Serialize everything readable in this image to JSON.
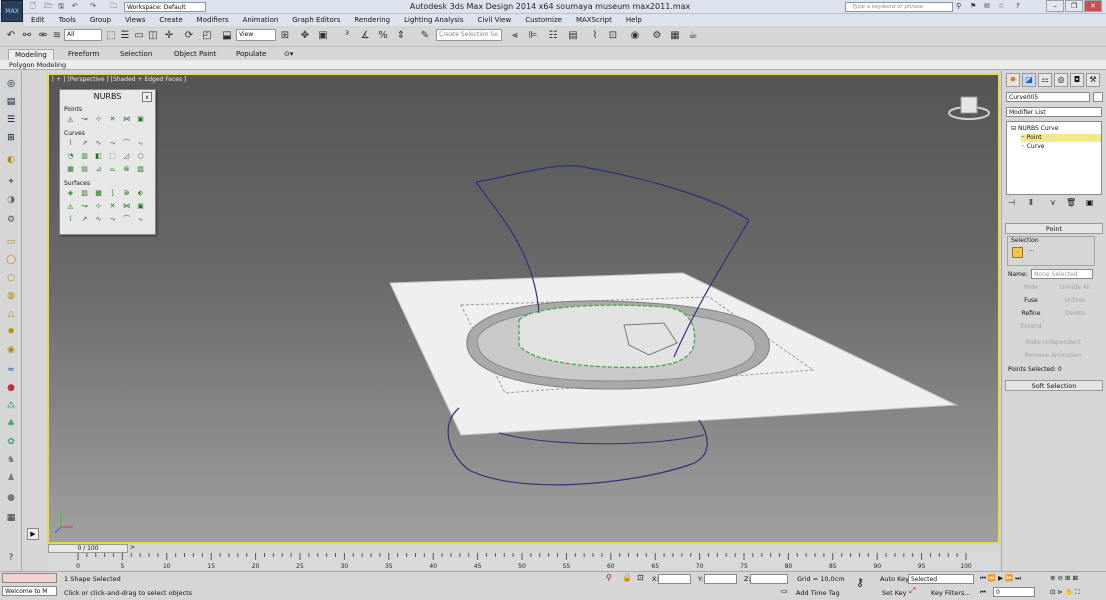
{
  "window": {
    "title": "Autodesk 3ds Max Design 2014 x64     soumaya museum max2011.max",
    "app_icon": "MAX",
    "workspace": "Workspace: Default",
    "search_placeholder": "Type a keyword or phrase",
    "minimize": "–",
    "maximize": "❐",
    "close": "✕"
  },
  "menus": [
    "Edit",
    "Tools",
    "Group",
    "Views",
    "Create",
    "Modifiers",
    "Animation",
    "Graph Editors",
    "Rendering",
    "Lighting Analysis",
    "Civil View",
    "Customize",
    "MAXScript",
    "Help"
  ],
  "toolbar": {
    "selection_filter": "All",
    "reference_coord": "View",
    "named_selection_placeholder": "Create Selection Se"
  },
  "ribbon": {
    "tabs": [
      "Modeling",
      "Freeform",
      "Selection",
      "Object Paint",
      "Populate"
    ],
    "active_tab": "Modeling",
    "subtitle": "Polygon Modeling"
  },
  "viewport": {
    "label": "[ + ] [Perspective ] [Shaded + Edged Faces ]"
  },
  "nurbs": {
    "title": "NURBS",
    "close": "x",
    "sections": [
      {
        "name": "Points",
        "rows": 1
      },
      {
        "name": "Curves",
        "rows": 3
      },
      {
        "name": "Surfaces",
        "rows": 3
      }
    ]
  },
  "command_panel": {
    "object_name": "Curve005",
    "modifier_list": "Modifier List",
    "stack": [
      {
        "label": "NURBS Curve",
        "level": 0,
        "selected": false
      },
      {
        "label": "Point",
        "level": 1,
        "selected": true
      },
      {
        "label": "Curve",
        "level": 1,
        "selected": false
      }
    ],
    "rollout_title": "Point",
    "selection_group": "Selection",
    "name_label": "Name:",
    "name_placeholder": "None Selected",
    "buttons": [
      {
        "label": "Hide",
        "enabled": false
      },
      {
        "label": "Unhide All",
        "enabled": false
      },
      {
        "label": "Fuse",
        "enabled": true
      },
      {
        "label": "Unfuse",
        "enabled": false
      },
      {
        "label": "Refine",
        "enabled": true
      },
      {
        "label": "Delete",
        "enabled": false
      },
      {
        "label": "Extend",
        "enabled": false
      }
    ],
    "make_independent": "Make Independent",
    "remove_animation": "Remove Animation",
    "points_selected": "Points Selected: 0",
    "soft_selection": "Soft Selection"
  },
  "timeline": {
    "position": "0 / 100",
    "ticks": [
      "0",
      "5",
      "10",
      "15",
      "20",
      "25",
      "30",
      "35",
      "40",
      "45",
      "50",
      "55",
      "60",
      "65",
      "70",
      "75",
      "80",
      "85",
      "90",
      "95",
      "100"
    ]
  },
  "status": {
    "maxscript": "Welcome to M",
    "shape_selected": "1 Shape Selected",
    "prompt": "Click or click-and-drag to select objects",
    "x_label": "X:",
    "y_label": "Y:",
    "z_label": "Z:",
    "grid": "Grid = 10,0cm",
    "auto_key": "Auto Key",
    "auto_key_mode": "Selected",
    "set_key": "Set Key",
    "key_filters": "Key Filters...",
    "add_time_tag": "Add Time Tag",
    "frame": "0"
  },
  "colors": {
    "viewport_border": "#e9d94c",
    "curve": "#2a3479",
    "selected_item": "#f3e98c"
  }
}
